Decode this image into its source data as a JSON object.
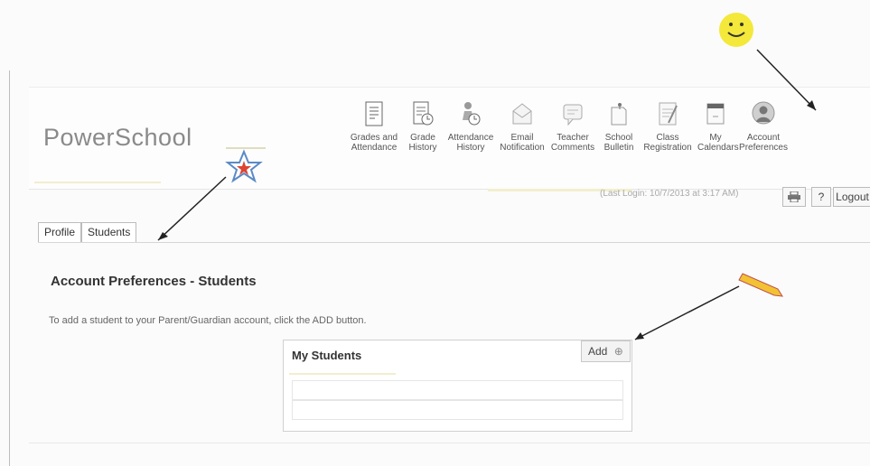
{
  "app": {
    "logo": "PowerSchool"
  },
  "nav": [
    {
      "id": "grades",
      "icon": "grades-icon",
      "line1": "Grades and",
      "line2": "Attendance"
    },
    {
      "id": "history",
      "icon": "grade-history-icon",
      "line1": "Grade",
      "line2": "History"
    },
    {
      "id": "attendance",
      "icon": "attendance-history-icon",
      "line1": "Attendance",
      "line2": "History"
    },
    {
      "id": "email",
      "icon": "email-icon",
      "line1": "Email",
      "line2": "Notification"
    },
    {
      "id": "comments",
      "icon": "teacher-comments-icon",
      "line1": "Teacher",
      "line2": "Comments"
    },
    {
      "id": "bulletin",
      "icon": "bulletin-icon",
      "line1": "School",
      "line2": "Bulletin"
    },
    {
      "id": "registration",
      "icon": "registration-icon",
      "line1": "Class",
      "line2": "Registration"
    },
    {
      "id": "calendars",
      "icon": "calendar-icon",
      "line1": "My",
      "line2": "Calendars"
    },
    {
      "id": "preferences",
      "icon": "account-preferences-icon",
      "line1": "Account",
      "line2": "Preferences"
    }
  ],
  "toolbar": {
    "last_login": "(Last Login: 10/7/2013 at 3:17 AM)",
    "help": "?",
    "logout": "Logout"
  },
  "tabs": [
    "Profile",
    "Students"
  ],
  "page": {
    "title": "Account Preferences - Students",
    "instructions": "To add a student to your Parent/Guardian account, click the ADD button."
  },
  "students_box": {
    "title": "My Students",
    "add_label": "Add",
    "add_icon": "plus-circle-icon"
  }
}
